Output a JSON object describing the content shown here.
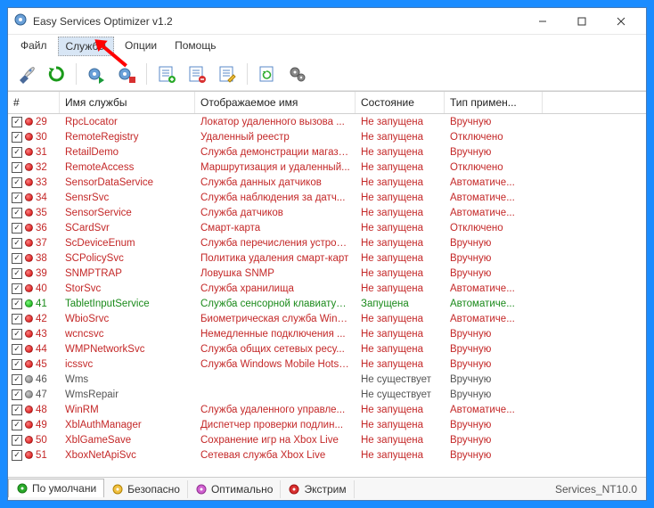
{
  "title": "Easy Services Optimizer v1.2",
  "menu": {
    "file": "Файл",
    "services": "Службы",
    "options": "Опции",
    "help": "Помощь"
  },
  "columns": {
    "num": "#",
    "name": "Имя службы",
    "disp": "Отображаемое имя",
    "state": "Состояние",
    "type": "Тип примен..."
  },
  "rows": [
    {
      "n": "29",
      "name": "RpcLocator",
      "disp": "Локатор удаленного вызова ...",
      "state": "Не запущена",
      "type": "Вручную",
      "dot": "red",
      "cls": "c-red"
    },
    {
      "n": "30",
      "name": "RemoteRegistry",
      "disp": "Удаленный реестр",
      "state": "Не запущена",
      "type": "Отключено",
      "dot": "red",
      "cls": "c-red"
    },
    {
      "n": "31",
      "name": "RetailDemo",
      "disp": "Служба демонстрации магазина",
      "state": "Не запущена",
      "type": "Вручную",
      "dot": "red",
      "cls": "c-red"
    },
    {
      "n": "32",
      "name": "RemoteAccess",
      "disp": "Маршрутизация и удаленный...",
      "state": "Не запущена",
      "type": "Отключено",
      "dot": "red",
      "cls": "c-red"
    },
    {
      "n": "33",
      "name": "SensorDataService",
      "disp": "Служба данных датчиков",
      "state": "Не запущена",
      "type": "Автоматиче...",
      "dot": "red",
      "cls": "c-red"
    },
    {
      "n": "34",
      "name": "SensrSvc",
      "disp": "Служба наблюдения за датч...",
      "state": "Не запущена",
      "type": "Автоматиче...",
      "dot": "red",
      "cls": "c-red"
    },
    {
      "n": "35",
      "name": "SensorService",
      "disp": "Служба датчиков",
      "state": "Не запущена",
      "type": "Автоматиче...",
      "dot": "red",
      "cls": "c-red"
    },
    {
      "n": "36",
      "name": "SCardSvr",
      "disp": "Смарт-карта",
      "state": "Не запущена",
      "type": "Отключено",
      "dot": "red",
      "cls": "c-red"
    },
    {
      "n": "37",
      "name": "ScDeviceEnum",
      "disp": "Служба перечисления устрой...",
      "state": "Не запущена",
      "type": "Вручную",
      "dot": "red",
      "cls": "c-red"
    },
    {
      "n": "38",
      "name": "SCPolicySvc",
      "disp": "Политика удаления смарт-карт",
      "state": "Не запущена",
      "type": "Вручную",
      "dot": "red",
      "cls": "c-red"
    },
    {
      "n": "39",
      "name": "SNMPTRAP",
      "disp": "Ловушка SNMP",
      "state": "Не запущена",
      "type": "Вручную",
      "dot": "red",
      "cls": "c-red"
    },
    {
      "n": "40",
      "name": "StorSvc",
      "disp": "Служба хранилища",
      "state": "Не запущена",
      "type": "Автоматиче...",
      "dot": "red",
      "cls": "c-red"
    },
    {
      "n": "41",
      "name": "TabletInputService",
      "disp": "Служба сенсорной клавиатур...",
      "state": "Запущена",
      "type": "Автоматиче...",
      "dot": "green",
      "cls": "c-green"
    },
    {
      "n": "42",
      "name": "WbioSrvc",
      "disp": "Биометрическая служба Wind...",
      "state": "Не запущена",
      "type": "Автоматиче...",
      "dot": "red",
      "cls": "c-red"
    },
    {
      "n": "43",
      "name": "wcncsvc",
      "disp": "Немедленные подключения ...",
      "state": "Не запущена",
      "type": "Вручную",
      "dot": "red",
      "cls": "c-red"
    },
    {
      "n": "44",
      "name": "WMPNetworkSvc",
      "disp": "Служба общих сетевых ресу...",
      "state": "Не запущена",
      "type": "Вручную",
      "dot": "red",
      "cls": "c-red"
    },
    {
      "n": "45",
      "name": "icssvc",
      "disp": "Служба Windows Mobile Hotspot",
      "state": "Не запущена",
      "type": "Вручную",
      "dot": "red",
      "cls": "c-red"
    },
    {
      "n": "46",
      "name": "Wms",
      "disp": "",
      "state": "Не существует",
      "type": "Вручную",
      "dot": "gray",
      "cls": "c-gray"
    },
    {
      "n": "47",
      "name": "WmsRepair",
      "disp": "",
      "state": "Не существует",
      "type": "Вручную",
      "dot": "gray",
      "cls": "c-gray"
    },
    {
      "n": "48",
      "name": "WinRM",
      "disp": "Служба удаленного управле...",
      "state": "Не запущена",
      "type": "Автоматиче...",
      "dot": "red",
      "cls": "c-red"
    },
    {
      "n": "49",
      "name": "XblAuthManager",
      "disp": "Диспетчер проверки подлин...",
      "state": "Не запущена",
      "type": "Вручную",
      "dot": "red",
      "cls": "c-red"
    },
    {
      "n": "50",
      "name": "XblGameSave",
      "disp": "Сохранение игр на Xbox Live",
      "state": "Не запущена",
      "type": "Вручную",
      "dot": "red",
      "cls": "c-red"
    },
    {
      "n": "51",
      "name": "XboxNetApiSvc",
      "disp": "Сетевая служба Xbox Live",
      "state": "Не запущена",
      "type": "Вручную",
      "dot": "red",
      "cls": "c-red"
    }
  ],
  "tabs": {
    "default": "По умолчани",
    "safe": "Безопасно",
    "optimal": "Оптимально",
    "extreme": "Экстрим"
  },
  "status_right": "Services_NT10.0"
}
